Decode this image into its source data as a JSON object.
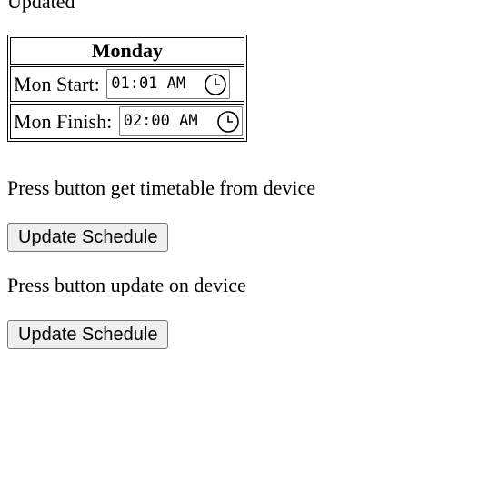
{
  "status": "Updated",
  "schedule": {
    "day_header": "Monday",
    "rows": [
      {
        "label": "Mon Start:",
        "value": "01:01 AM"
      },
      {
        "label": "Mon Finish:",
        "value": "02:00 AM"
      }
    ],
    "time_picker_icon": "clock-icon"
  },
  "actions": [
    {
      "prompt": "Press button get timetable from device",
      "button_label": "Update Schedule"
    },
    {
      "prompt": "Press button update on device",
      "button_label": "Update Schedule"
    }
  ]
}
